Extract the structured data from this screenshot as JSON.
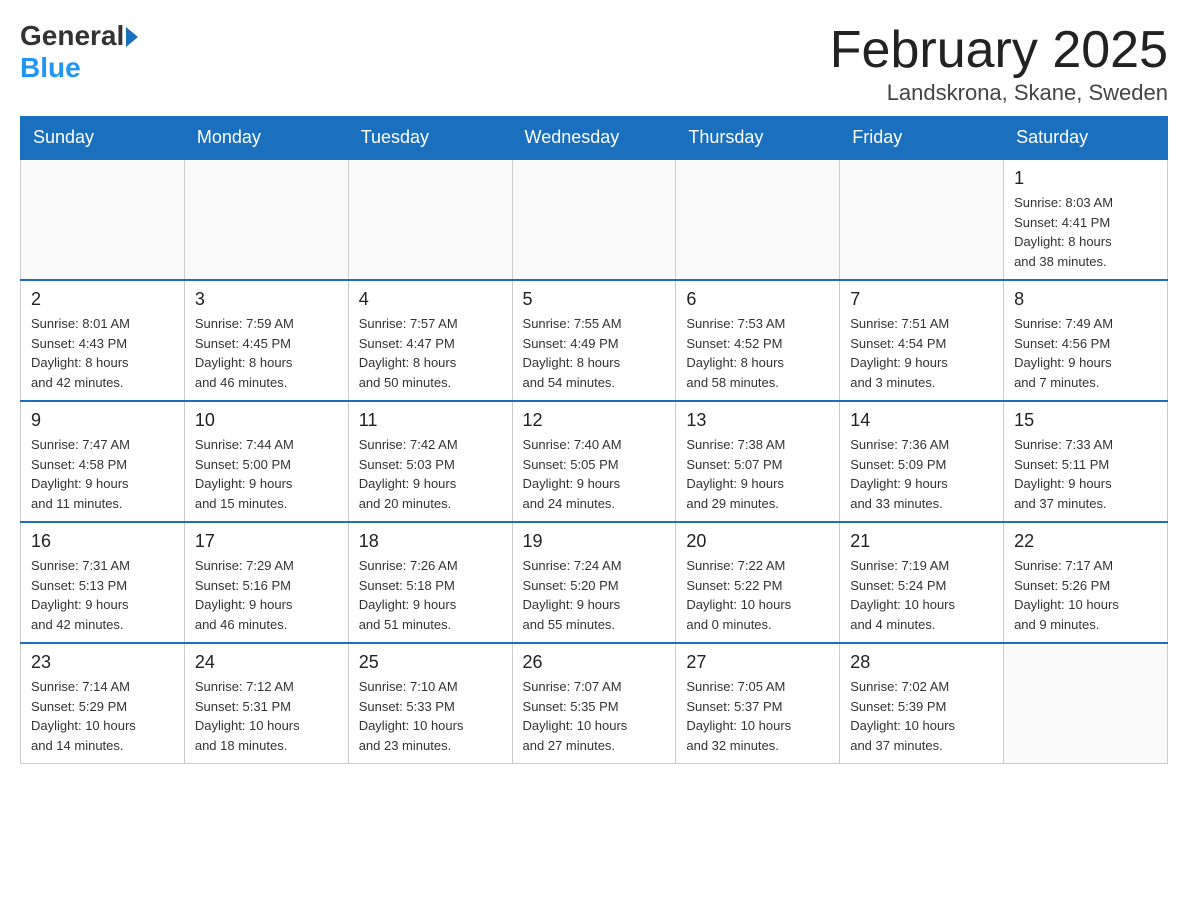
{
  "logo": {
    "general": "General",
    "blue": "Blue"
  },
  "title": "February 2025",
  "location": "Landskrona, Skane, Sweden",
  "days_of_week": [
    "Sunday",
    "Monday",
    "Tuesday",
    "Wednesday",
    "Thursday",
    "Friday",
    "Saturday"
  ],
  "weeks": [
    [
      {
        "day": "",
        "info": ""
      },
      {
        "day": "",
        "info": ""
      },
      {
        "day": "",
        "info": ""
      },
      {
        "day": "",
        "info": ""
      },
      {
        "day": "",
        "info": ""
      },
      {
        "day": "",
        "info": ""
      },
      {
        "day": "1",
        "info": "Sunrise: 8:03 AM\nSunset: 4:41 PM\nDaylight: 8 hours\nand 38 minutes."
      }
    ],
    [
      {
        "day": "2",
        "info": "Sunrise: 8:01 AM\nSunset: 4:43 PM\nDaylight: 8 hours\nand 42 minutes."
      },
      {
        "day": "3",
        "info": "Sunrise: 7:59 AM\nSunset: 4:45 PM\nDaylight: 8 hours\nand 46 minutes."
      },
      {
        "day": "4",
        "info": "Sunrise: 7:57 AM\nSunset: 4:47 PM\nDaylight: 8 hours\nand 50 minutes."
      },
      {
        "day": "5",
        "info": "Sunrise: 7:55 AM\nSunset: 4:49 PM\nDaylight: 8 hours\nand 54 minutes."
      },
      {
        "day": "6",
        "info": "Sunrise: 7:53 AM\nSunset: 4:52 PM\nDaylight: 8 hours\nand 58 minutes."
      },
      {
        "day": "7",
        "info": "Sunrise: 7:51 AM\nSunset: 4:54 PM\nDaylight: 9 hours\nand 3 minutes."
      },
      {
        "day": "8",
        "info": "Sunrise: 7:49 AM\nSunset: 4:56 PM\nDaylight: 9 hours\nand 7 minutes."
      }
    ],
    [
      {
        "day": "9",
        "info": "Sunrise: 7:47 AM\nSunset: 4:58 PM\nDaylight: 9 hours\nand 11 minutes."
      },
      {
        "day": "10",
        "info": "Sunrise: 7:44 AM\nSunset: 5:00 PM\nDaylight: 9 hours\nand 15 minutes."
      },
      {
        "day": "11",
        "info": "Sunrise: 7:42 AM\nSunset: 5:03 PM\nDaylight: 9 hours\nand 20 minutes."
      },
      {
        "day": "12",
        "info": "Sunrise: 7:40 AM\nSunset: 5:05 PM\nDaylight: 9 hours\nand 24 minutes."
      },
      {
        "day": "13",
        "info": "Sunrise: 7:38 AM\nSunset: 5:07 PM\nDaylight: 9 hours\nand 29 minutes."
      },
      {
        "day": "14",
        "info": "Sunrise: 7:36 AM\nSunset: 5:09 PM\nDaylight: 9 hours\nand 33 minutes."
      },
      {
        "day": "15",
        "info": "Sunrise: 7:33 AM\nSunset: 5:11 PM\nDaylight: 9 hours\nand 37 minutes."
      }
    ],
    [
      {
        "day": "16",
        "info": "Sunrise: 7:31 AM\nSunset: 5:13 PM\nDaylight: 9 hours\nand 42 minutes."
      },
      {
        "day": "17",
        "info": "Sunrise: 7:29 AM\nSunset: 5:16 PM\nDaylight: 9 hours\nand 46 minutes."
      },
      {
        "day": "18",
        "info": "Sunrise: 7:26 AM\nSunset: 5:18 PM\nDaylight: 9 hours\nand 51 minutes."
      },
      {
        "day": "19",
        "info": "Sunrise: 7:24 AM\nSunset: 5:20 PM\nDaylight: 9 hours\nand 55 minutes."
      },
      {
        "day": "20",
        "info": "Sunrise: 7:22 AM\nSunset: 5:22 PM\nDaylight: 10 hours\nand 0 minutes."
      },
      {
        "day": "21",
        "info": "Sunrise: 7:19 AM\nSunset: 5:24 PM\nDaylight: 10 hours\nand 4 minutes."
      },
      {
        "day": "22",
        "info": "Sunrise: 7:17 AM\nSunset: 5:26 PM\nDaylight: 10 hours\nand 9 minutes."
      }
    ],
    [
      {
        "day": "23",
        "info": "Sunrise: 7:14 AM\nSunset: 5:29 PM\nDaylight: 10 hours\nand 14 minutes."
      },
      {
        "day": "24",
        "info": "Sunrise: 7:12 AM\nSunset: 5:31 PM\nDaylight: 10 hours\nand 18 minutes."
      },
      {
        "day": "25",
        "info": "Sunrise: 7:10 AM\nSunset: 5:33 PM\nDaylight: 10 hours\nand 23 minutes."
      },
      {
        "day": "26",
        "info": "Sunrise: 7:07 AM\nSunset: 5:35 PM\nDaylight: 10 hours\nand 27 minutes."
      },
      {
        "day": "27",
        "info": "Sunrise: 7:05 AM\nSunset: 5:37 PM\nDaylight: 10 hours\nand 32 minutes."
      },
      {
        "day": "28",
        "info": "Sunrise: 7:02 AM\nSunset: 5:39 PM\nDaylight: 10 hours\nand 37 minutes."
      },
      {
        "day": "",
        "info": ""
      }
    ]
  ]
}
